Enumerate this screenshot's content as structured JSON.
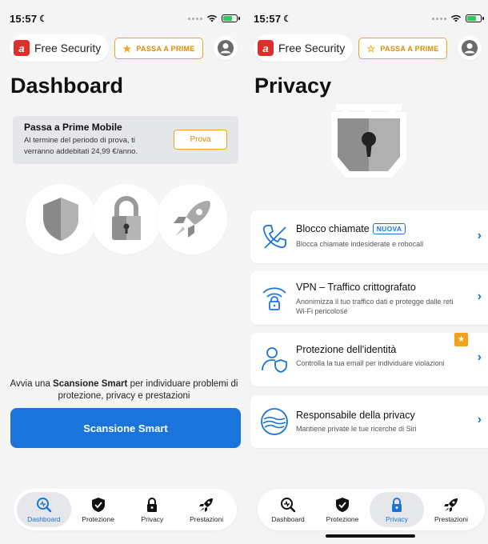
{
  "left": {
    "status": {
      "time": "15:57"
    },
    "brand": {
      "name": "Free Security",
      "logo_letter": "a"
    },
    "prime_button": {
      "label": "PASSA A PRIME"
    },
    "title": "Dashboard",
    "promo": {
      "title": "Passa a Prime Mobile",
      "text": "Al termine del periodo di prova, ti verranno addebitati 24,99 €/anno.",
      "button": "Prova"
    },
    "scan": {
      "text_before": "Avvia una ",
      "text_bold": "Scansione Smart",
      "text_after": " per individuare problemi di protezione, privacy e prestazioni",
      "button": "Scansione Smart"
    },
    "nav": [
      {
        "label": "Dashboard",
        "icon": "dashboard-search-icon",
        "active": true
      },
      {
        "label": "Protezione",
        "icon": "shield-check-icon",
        "active": false
      },
      {
        "label": "Privacy",
        "icon": "lock-icon",
        "active": false
      },
      {
        "label": "Prestazioni",
        "icon": "rocket-icon",
        "active": false
      }
    ]
  },
  "right": {
    "status": {
      "time": "15:57"
    },
    "brand": {
      "name": "Free Security",
      "logo_letter": "a"
    },
    "prime_button": {
      "label": "PASSA A PRIME"
    },
    "title": "Privacy",
    "cards": [
      {
        "title": "Blocco chiamate",
        "badge": "NUOVA",
        "desc": "Blocca chiamate indesiderate e robocall",
        "icon": "phone-block-icon"
      },
      {
        "title": "VPN – Traffico crittografato",
        "desc": "Anonimizza il tuo traffico dati e protegge dalle reti Wi-Fi pericolose",
        "icon": "wifi-lock-icon"
      },
      {
        "title": "Protezione dell'identità",
        "desc": "Controlla la tua email per individuare violazioni",
        "icon": "identity-shield-icon",
        "premium": true
      },
      {
        "title": "Responsabile della privacy",
        "desc": "Mantiene private le tue ricerche di Siri",
        "icon": "privacy-advisor-icon"
      }
    ],
    "nav": [
      {
        "label": "Dashboard",
        "icon": "dashboard-search-icon",
        "active": false
      },
      {
        "label": "Protezione",
        "icon": "shield-check-icon",
        "active": false
      },
      {
        "label": "Privacy",
        "icon": "lock-icon",
        "active": true
      },
      {
        "label": "Prestazioni",
        "icon": "rocket-icon",
        "active": false
      }
    ]
  },
  "colors": {
    "accent": "#1a74db",
    "prime": "#f2a31a",
    "brand_red": "#e02e2a",
    "battery_green": "#34c759"
  }
}
